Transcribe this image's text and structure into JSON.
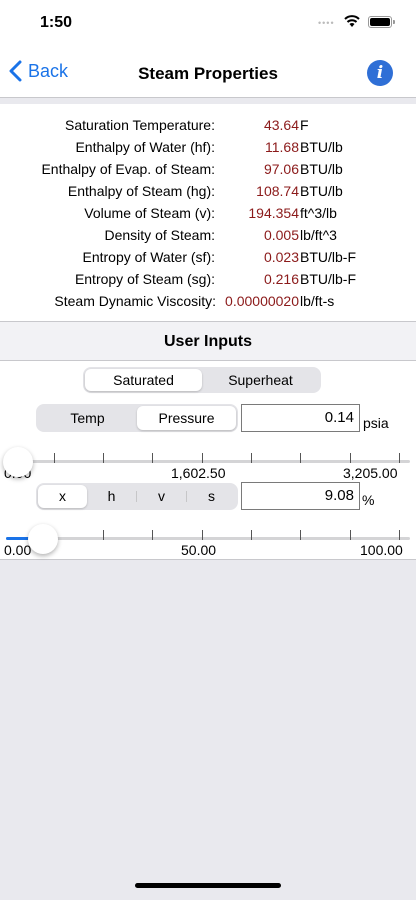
{
  "status_bar": {
    "time": "1:50",
    "signal_text": "••••"
  },
  "nav": {
    "back_label": "Back",
    "title": "Steam Properties",
    "info_glyph": "i"
  },
  "properties": [
    {
      "label": "Saturation Temperature:",
      "value": "43.64",
      "unit": "F"
    },
    {
      "label": "Enthalpy of Water (hf):",
      "value": "11.68",
      "unit": "BTU/lb"
    },
    {
      "label": "Enthalpy of Evap. of Steam:",
      "value": "97.06",
      "unit": "BTU/lb"
    },
    {
      "label": "Enthalpy of Steam (hg):",
      "value": "108.74",
      "unit": "BTU/lb"
    },
    {
      "label": "Volume of Steam (v):",
      "value": "194.354",
      "unit": "ft^3/lb"
    },
    {
      "label": "Density of Steam:",
      "value": "0.005",
      "unit": "lb/ft^3"
    },
    {
      "label": "Entropy of Water (sf):",
      "value": "0.023",
      "unit": "BTU/lb-F"
    },
    {
      "label": "Entropy of Steam (sg):",
      "value": "0.216",
      "unit": "BTU/lb-F"
    },
    {
      "label": "Steam Dynamic Viscosity:",
      "value": "0.00000020",
      "unit": "lb/ft-s"
    }
  ],
  "inputs": {
    "header": "User Inputs",
    "mode_segment": {
      "options": [
        "Saturated",
        "Superheat"
      ],
      "selected": "Saturated"
    },
    "variable_segment": {
      "options": [
        "Temp",
        "Pressure"
      ],
      "selected": "Pressure"
    },
    "pressure_field": {
      "value": "0.14",
      "unit": "psia"
    },
    "pressure_slider": {
      "min_label": "0.00",
      "mid_label": "1,602.50",
      "max_label": "3,205.00",
      "value_fraction": 4e-05
    },
    "quality_segment": {
      "options": [
        "x",
        "h",
        "v",
        "s"
      ],
      "selected": "x"
    },
    "quality_field": {
      "value": "9.08",
      "unit": "%"
    },
    "quality_slider": {
      "min_label": "0.00",
      "mid_label": "50.00",
      "max_label": "100.00",
      "value_fraction": 0.0908
    }
  },
  "colors": {
    "accent": "#1a73e8",
    "value_text": "#8b1a1a",
    "info_button": "#2f6fd6"
  }
}
